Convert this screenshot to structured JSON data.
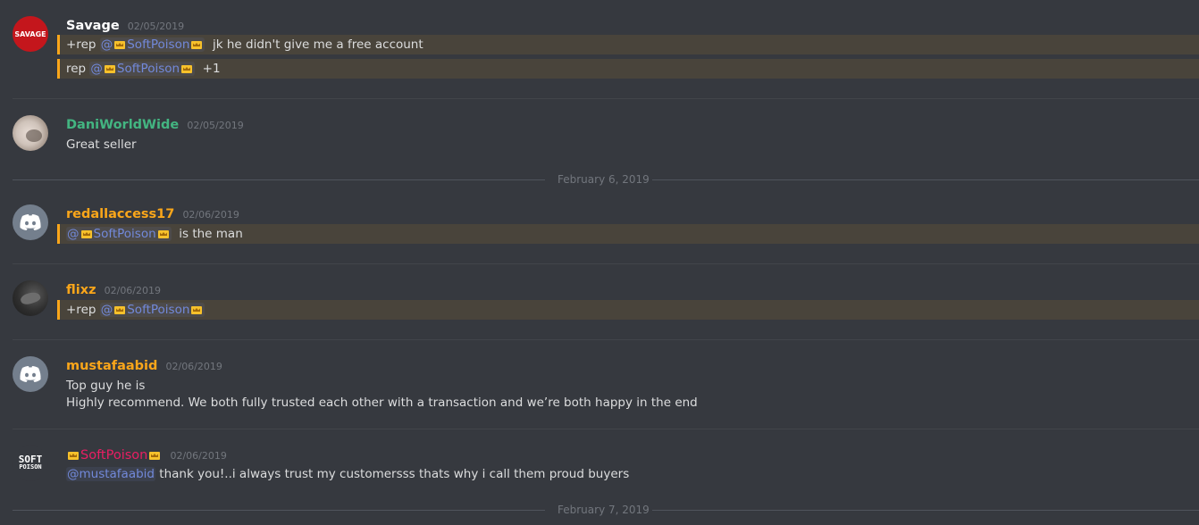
{
  "colors": {
    "background": "#36393f",
    "mention": "#7289da",
    "highlight_bar": "#faa61a",
    "timestamp": "#72767d"
  },
  "messages": [
    {
      "author": "Savage",
      "author_color": "#ffffff",
      "avatar": "savage-logo",
      "avatar_text": "SAVAGE",
      "timestamp": "02/05/2019",
      "lines": [
        {
          "prefix": "+rep ",
          "mention": "@",
          "mention_name": "SoftPoison",
          "suffix": "  jk he didn't give me a free account",
          "highlighted": true
        },
        {
          "prefix": "rep ",
          "mention": "@",
          "mention_name": "SoftPoison",
          "suffix": "  +1",
          "highlighted": true
        }
      ]
    },
    {
      "author": "DaniWorldWide",
      "author_color": "#43b581",
      "avatar": "photo-avatar",
      "timestamp": "02/05/2019",
      "lines": [
        {
          "text": "Great seller"
        }
      ]
    },
    {
      "author": "redallaccess17",
      "author_color": "#faa61a",
      "avatar": "discord-default-avatar",
      "timestamp": "02/06/2019",
      "lines": [
        {
          "prefix": "",
          "mention": "@",
          "mention_name": "SoftPoison",
          "suffix": "  is the man",
          "highlighted": true
        }
      ]
    },
    {
      "author": "flixz",
      "author_color": "#faa61a",
      "avatar": "photo-avatar",
      "timestamp": "02/06/2019",
      "lines": [
        {
          "prefix": "+rep ",
          "mention": "@",
          "mention_name": "SoftPoison",
          "suffix": "",
          "highlighted": true
        }
      ]
    },
    {
      "author": "mustafaabid",
      "author_color": "#faa61a",
      "avatar": "discord-default-avatar",
      "timestamp": "02/06/2019",
      "lines": [
        {
          "text": "Top guy he is"
        },
        {
          "text": "Highly recommend. We both fully trusted each other with a transaction and we’re both happy in the end"
        }
      ]
    },
    {
      "author": "SoftPoison",
      "author_color": "#e91e63",
      "avatar": "softpoison-logo",
      "avatar_text_1": "SOFT",
      "avatar_text_2": "POISON",
      "timestamp": "02/06/2019",
      "lines": [
        {
          "mention": "@mustafaabid",
          "suffix": " thank you!..i always trust my customersss thats why i call them proud buyers"
        }
      ]
    }
  ],
  "dividers": {
    "feb6": "February 6, 2019",
    "feb7": "February 7, 2019"
  }
}
